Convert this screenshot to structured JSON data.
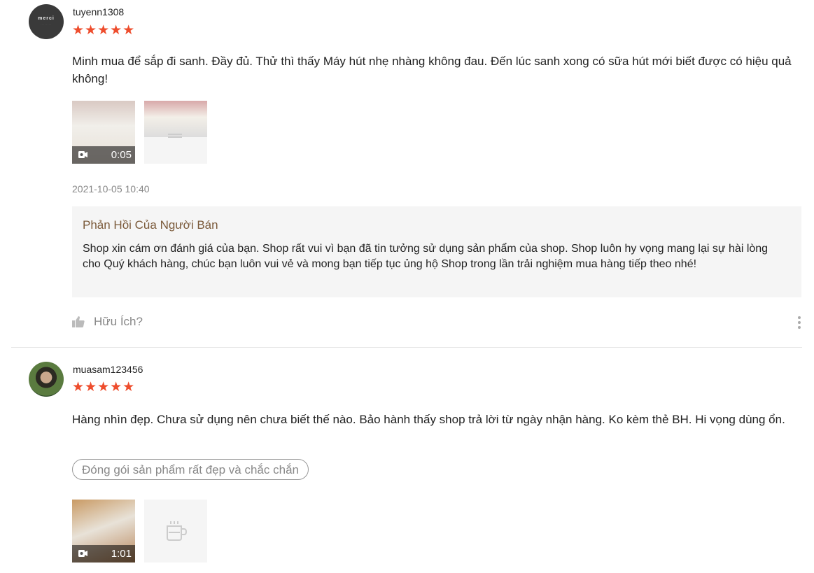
{
  "reviews": [
    {
      "username": "tuyenn1308",
      "avatar_text": "merci",
      "rating_stars": "★★★★★",
      "rating": 5,
      "content": "Minh mua để sắp đi sanh. Đầy đủ. Thử thì thấy Máy hút nhẹ nhàng không đau. Đến lúc sanh xong có sữa hút mới biết được có hiệu quả không!",
      "video_duration": "0:05",
      "timestamp": "2021-10-05 10:40",
      "seller_reply": {
        "title": "Phản Hồi Của Người Bán",
        "body": "Shop xin cám ơn đánh giá của bạn. Shop rất vui vì bạn đã tin tưởng sử dụng sản phẩm của shop. Shop luôn hy vọng mang lại sự hài lòng cho Quý khách hàng, chúc bạn luôn vui vẻ và mong bạn tiếp tục ủng hộ Shop trong lần trải nghiệm mua hàng tiếp theo nhé!"
      },
      "helpful_label": "Hữu Ích?"
    },
    {
      "username": "muasam123456",
      "rating_stars": "★★★★★",
      "rating": 5,
      "content": "Hàng nhìn đẹp. Chưa sử dụng nên chưa biết thế nào. Bảo hành thấy shop trả lời từ ngày nhận hàng. Ko kèm thẻ BH. Hi vọng dùng ổn.",
      "tag": "Đóng gói sản phẩm rất đẹp và chắc chắn",
      "video_duration": "1:01"
    }
  ],
  "colors": {
    "star": "#ee4d2d",
    "reply_title": "#7b5a3a",
    "muted": "#888888",
    "reply_bg": "#f5f5f5"
  },
  "icons": [
    "video-camera-icon",
    "image-placeholder-icon",
    "thumbs-up-icon",
    "more-vertical-icon"
  ]
}
